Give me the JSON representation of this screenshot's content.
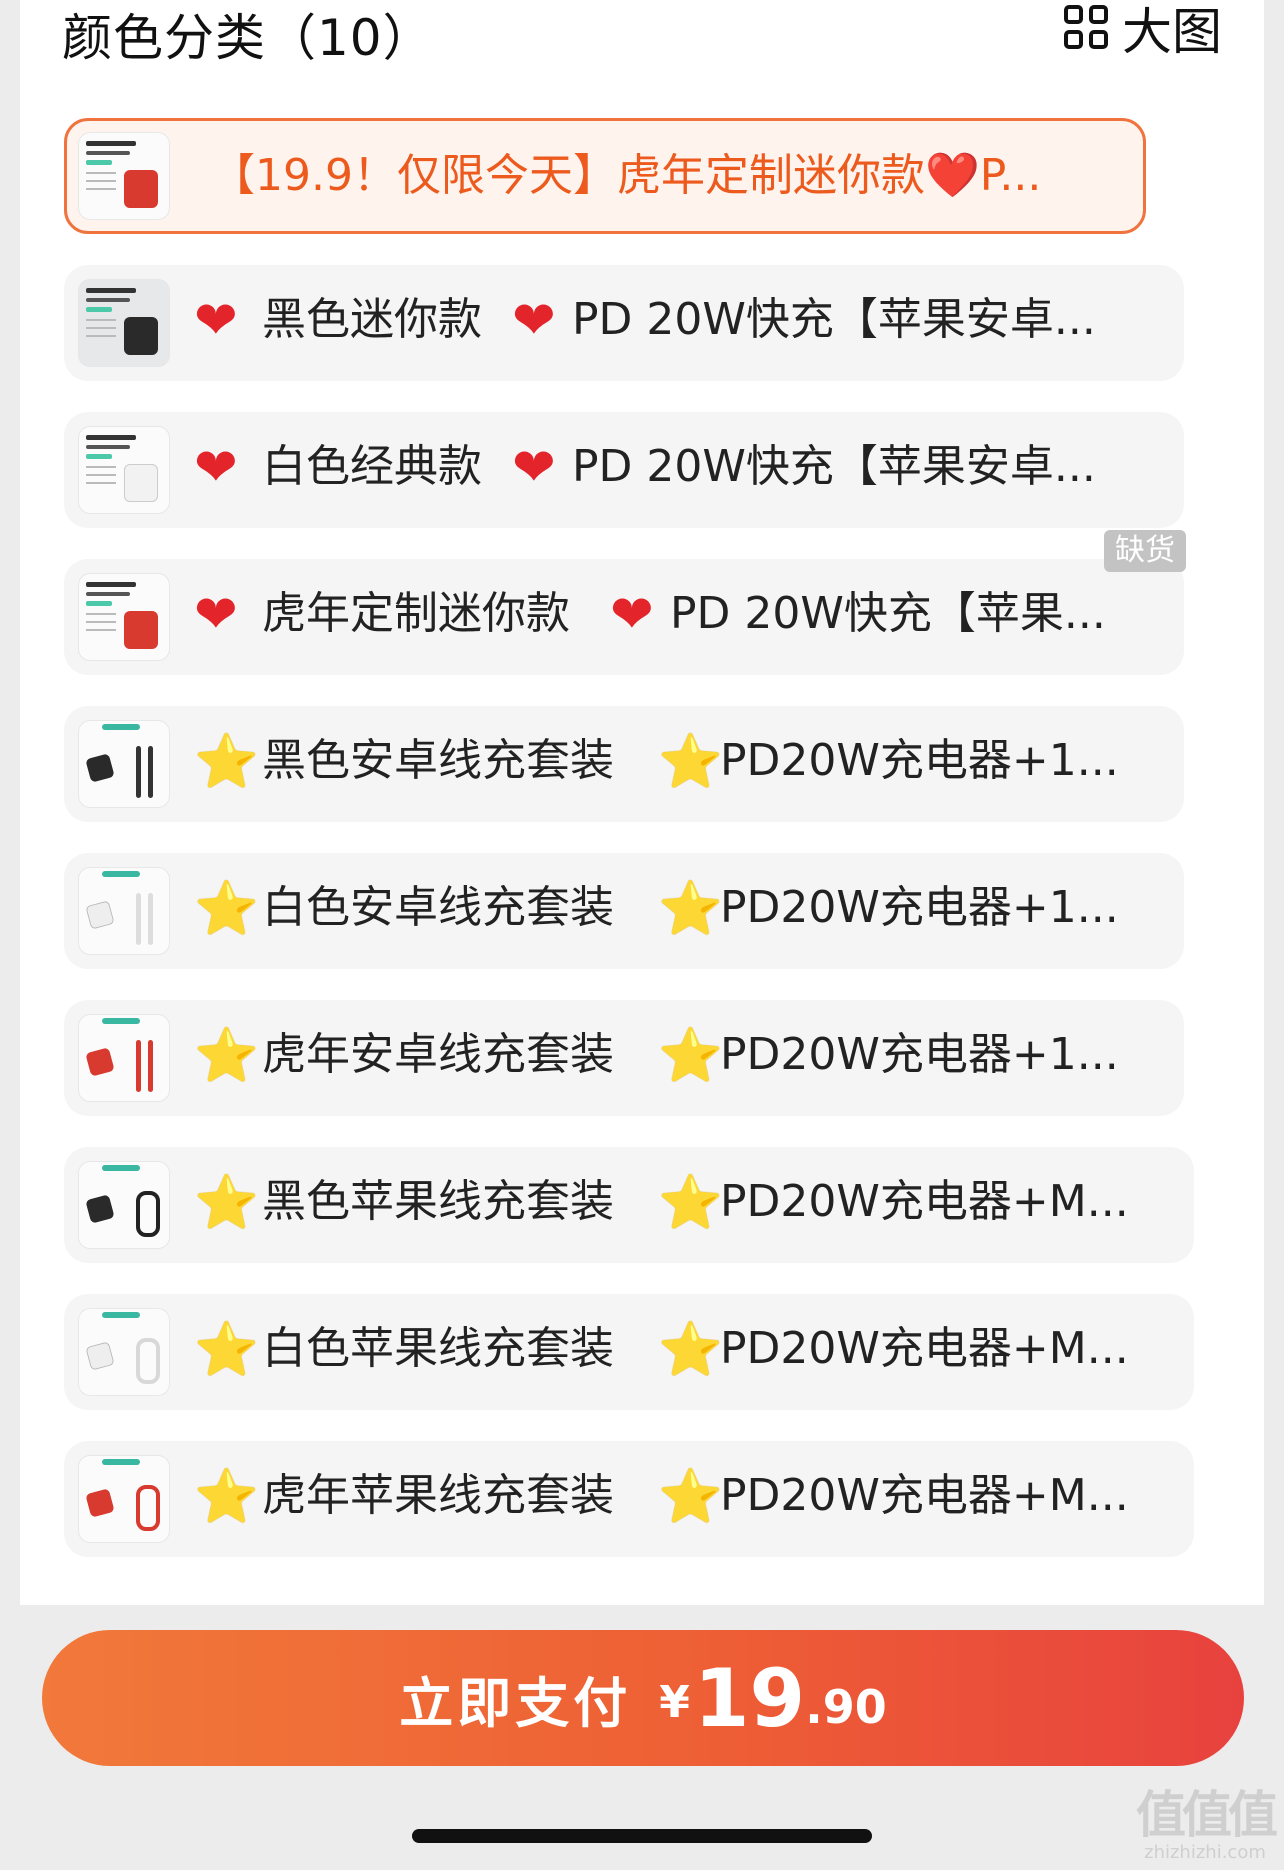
{
  "header": {
    "title": "颜色分类（10）",
    "view_toggle_label": "大图"
  },
  "options": [
    {
      "label": "【19.9！仅限今天】虎年定制迷你款❤️P...",
      "emoji": "",
      "selected": true,
      "charger_color": "#d83a2f"
    },
    {
      "label": "黑色迷你款",
      "emoji": "❤",
      "label2": "PD 20W快充【苹果安卓...",
      "charger_color": "#2a2a2a"
    },
    {
      "label": "白色经典款",
      "emoji": "❤",
      "label2": "PD 20W快充【苹果安卓...",
      "charger_color": "#f2f2f2"
    },
    {
      "label": "虎年定制迷你款",
      "emoji": "❤",
      "label2": "PD 20W快充【苹果...",
      "charger_color": "#d83a2f",
      "out_of_stock": true
    },
    {
      "label": "黑色安卓线充套装",
      "emoji": "⭐",
      "label2": "PD20W充电器+1...",
      "charger_color": "#2a2a2a"
    },
    {
      "label": "白色安卓线充套装",
      "emoji": "⭐",
      "label2": "PD20W充电器+1...",
      "charger_color": "#f2f2f2"
    },
    {
      "label": "虎年安卓线充套装",
      "emoji": "⭐",
      "label2": "PD20W充电器+1...",
      "charger_color": "#d83a2f"
    },
    {
      "label": "黑色苹果线充套装",
      "emoji": "⭐",
      "label2": "PD20W充电器+M...",
      "charger_color": "#2a2a2a"
    },
    {
      "label": "白色苹果线充套装",
      "emoji": "⭐",
      "label2": "PD20W充电器+M...",
      "charger_color": "#f2f2f2"
    },
    {
      "label": "虎年苹果线充套装",
      "emoji": "⭐",
      "label2": "PD20W充电器+M...",
      "charger_color": "#d83a2f"
    }
  ],
  "badge": "缺货",
  "pay_button": {
    "label": "立即支付",
    "currency": "¥",
    "price_int": "19",
    "price_dec": ".90"
  },
  "watermark": {
    "logo": "值值值",
    "url": "zhizhizhi.com"
  },
  "colors": {
    "accent": "#f0733d",
    "pay_gradient_start": "#f1793a",
    "pay_gradient_end": "#e8423e"
  }
}
